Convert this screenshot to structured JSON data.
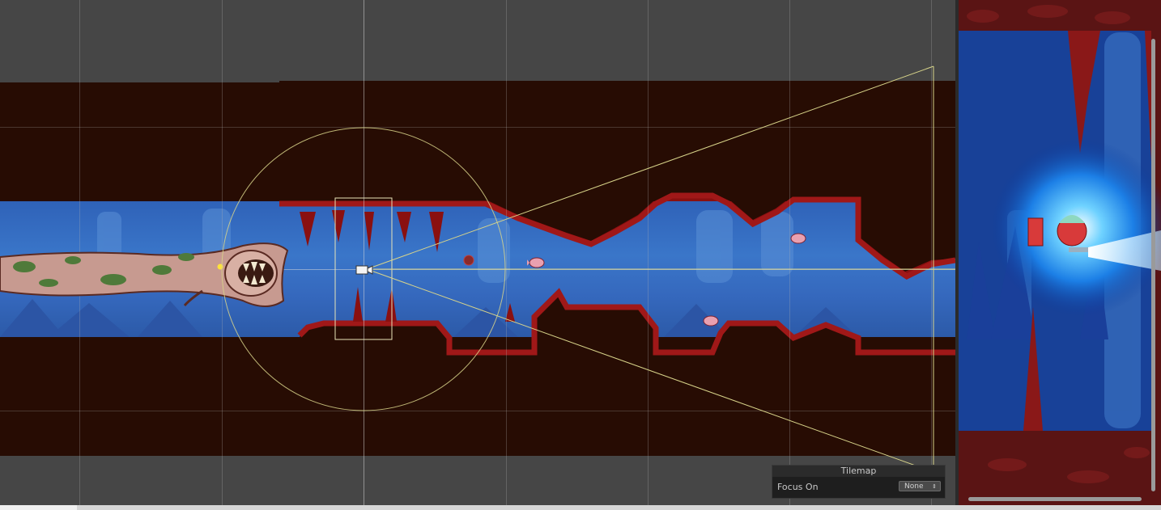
{
  "tilemap_panel": {
    "title": "Tilemap",
    "focus_label": "Focus On",
    "focus_value": "None",
    "dropdown_icon": "updown-arrows-icon"
  },
  "colors": {
    "editor_bg": "#464646",
    "world_bg": "#270c03",
    "water": "#3a76c9",
    "rock": "#8a1010",
    "gizmo": "#d8d48a"
  }
}
